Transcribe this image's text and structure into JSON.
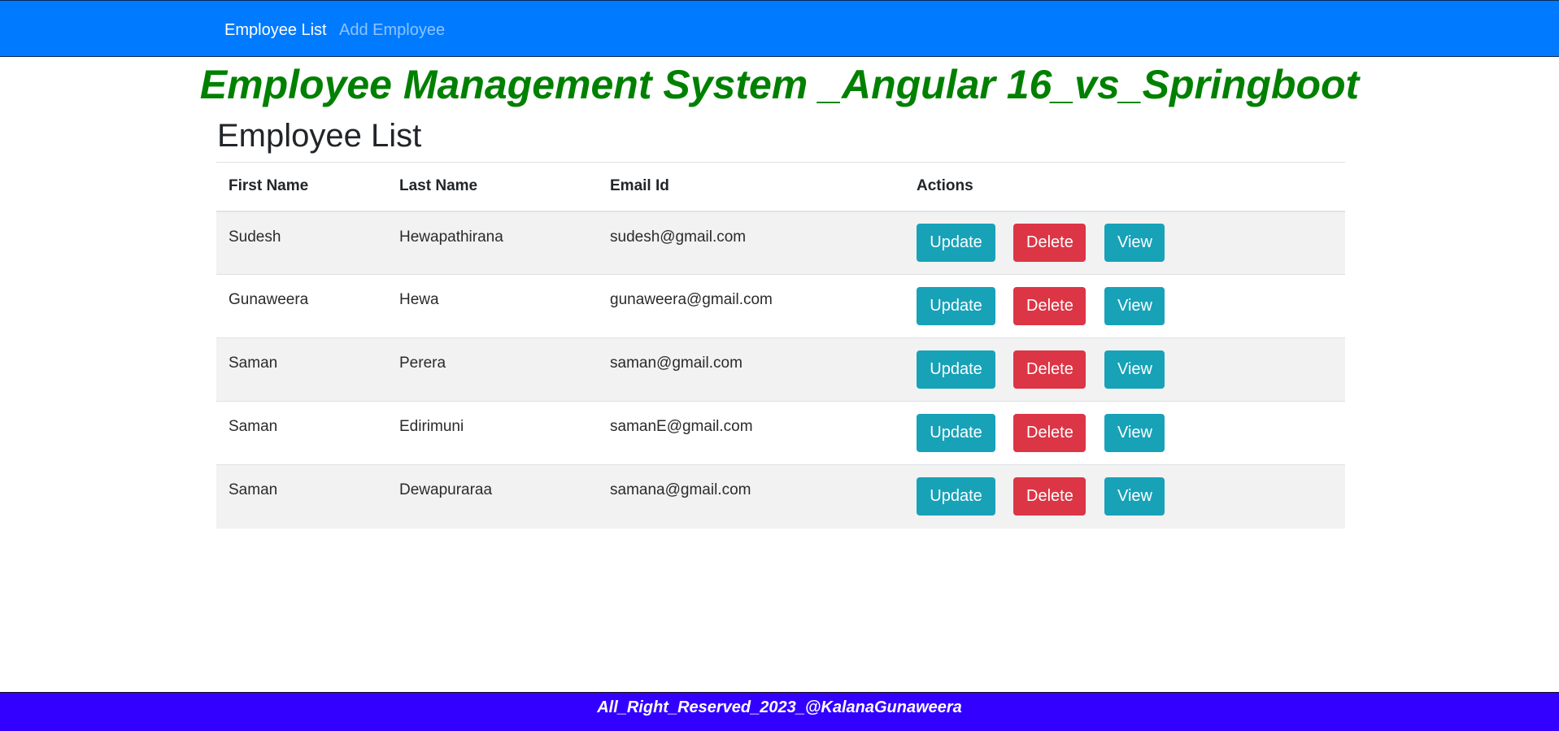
{
  "navbar": {
    "items": [
      {
        "label": "Employee List",
        "active": true
      },
      {
        "label": "Add Employee",
        "active": false
      }
    ],
    "background_color": "#007bff"
  },
  "header": {
    "app_title": "Employee Management System _Angular 16_vs_Springboot",
    "app_title_color": "#008000",
    "page_title": "Employee List"
  },
  "table": {
    "columns": [
      "First Name",
      "Last Name",
      "Email Id",
      "Actions"
    ],
    "rows": [
      {
        "first_name": "Sudesh",
        "last_name": "Hewapathirana",
        "email": "sudesh@gmail.com"
      },
      {
        "first_name": "Gunaweera",
        "last_name": "Hewa",
        "email": "gunaweera@gmail.com"
      },
      {
        "first_name": "Saman",
        "last_name": "Perera",
        "email": "saman@gmail.com"
      },
      {
        "first_name": "Saman",
        "last_name": "Edirimuni",
        "email": "samanE@gmail.com"
      },
      {
        "first_name": "Saman",
        "last_name": "Dewapuraraa",
        "email": "samana@gmail.com"
      }
    ],
    "actions": {
      "update_label": "Update",
      "delete_label": "Delete",
      "view_label": "View"
    },
    "colors": {
      "info": "#17a2b8",
      "danger": "#dc3545",
      "stripe": "#f2f2f2"
    }
  },
  "footer": {
    "text": "All_Right_Reserved_2023_@KalanaGunaweera",
    "background_color": "#3300ff"
  }
}
